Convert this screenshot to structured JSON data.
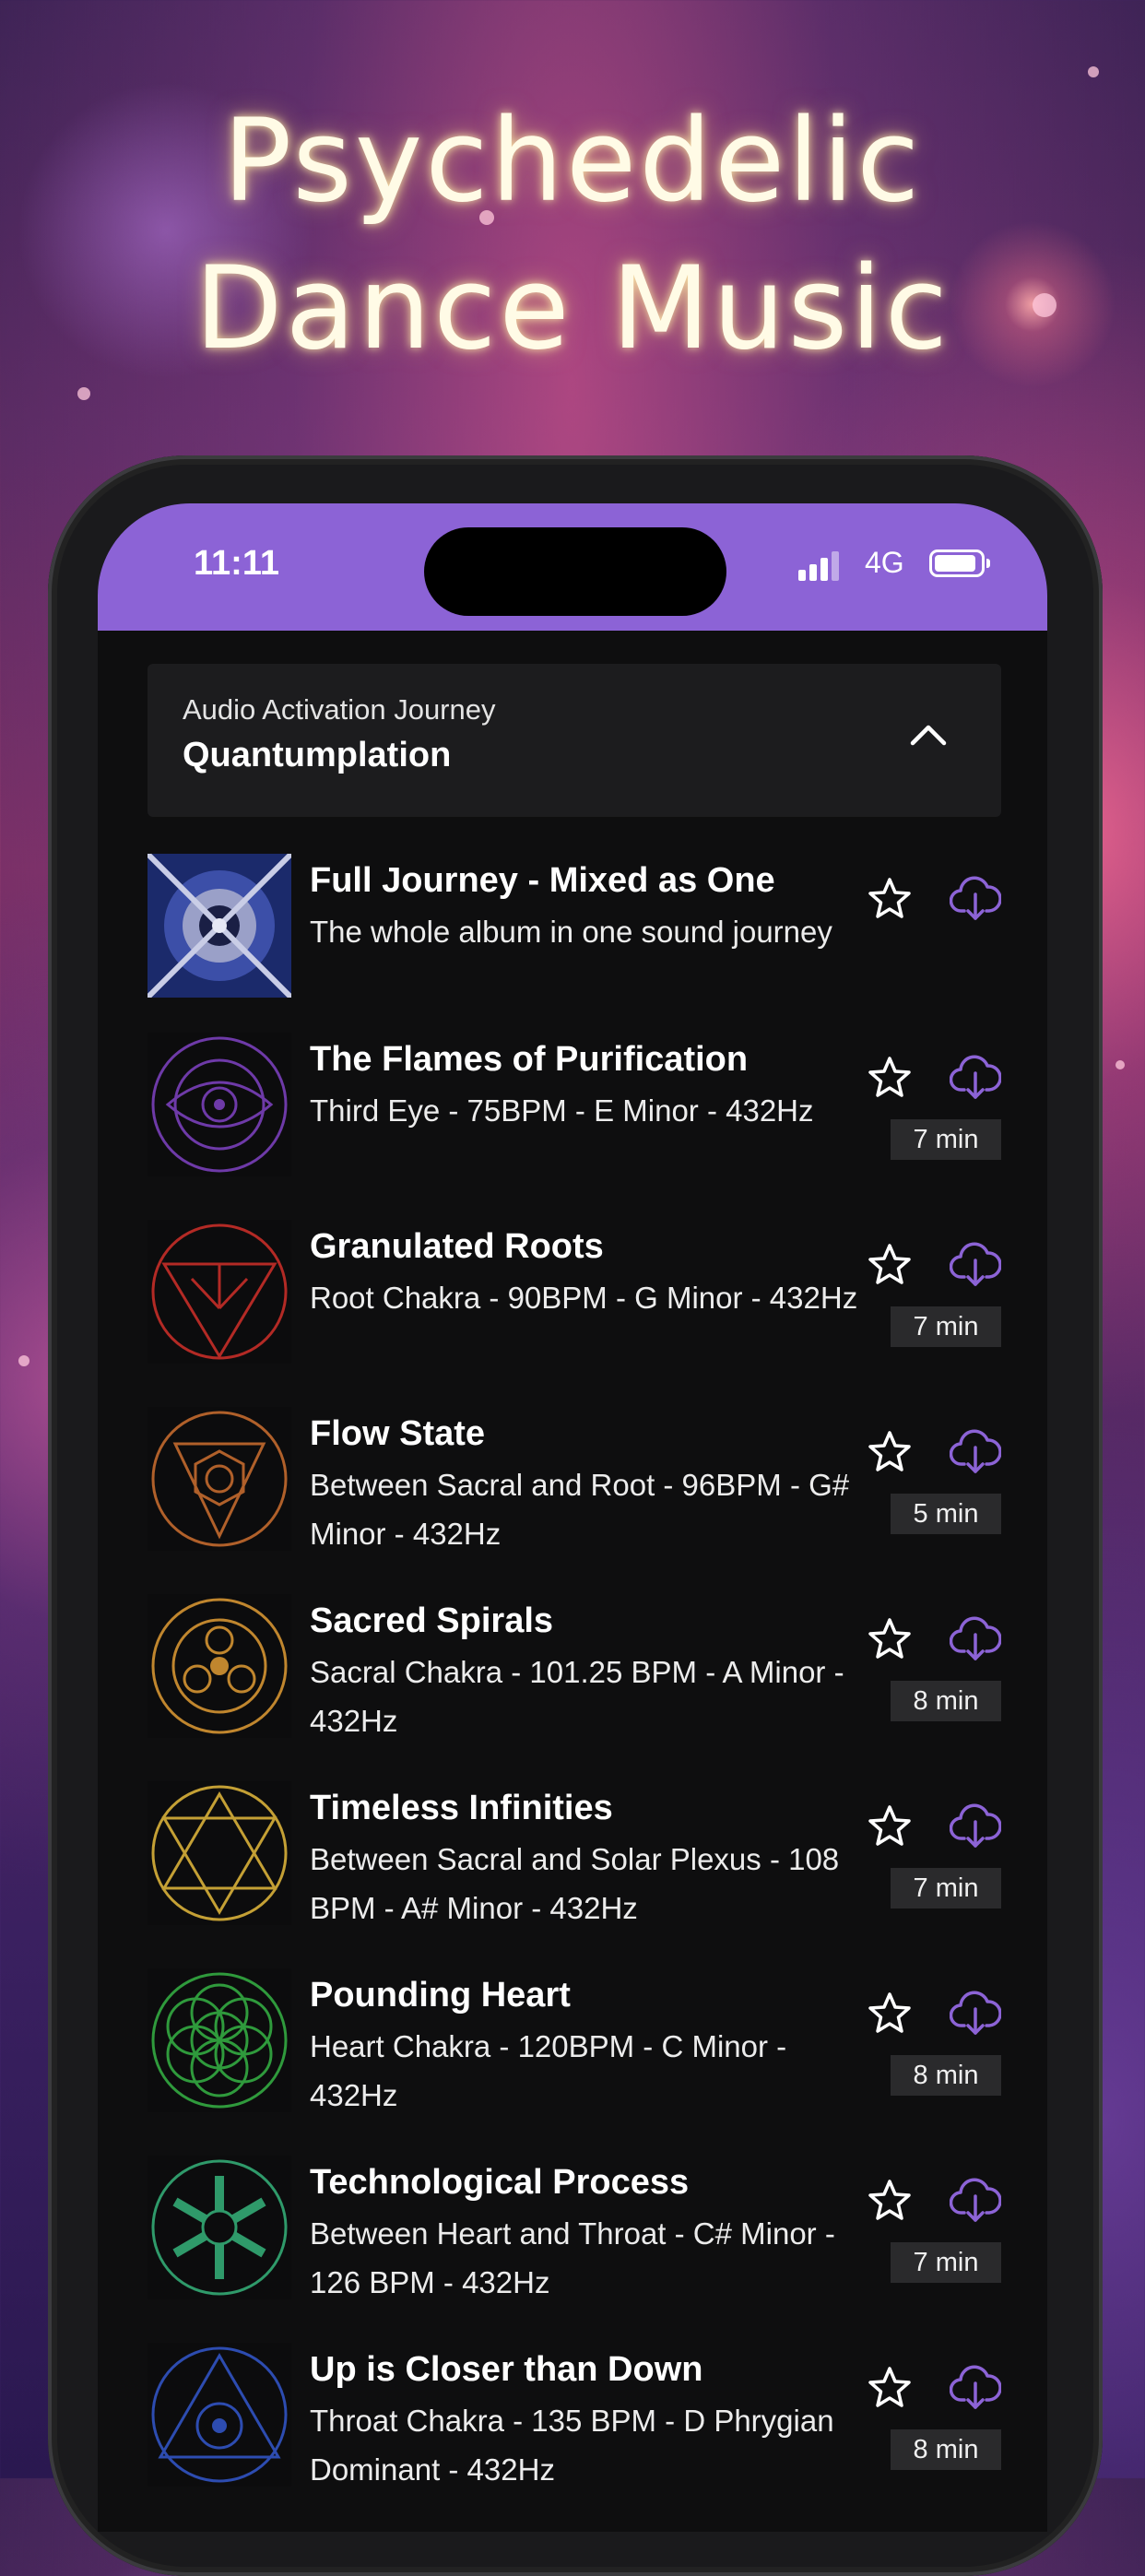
{
  "promo": {
    "title_line1": "Psychedelic",
    "title_line2": "Dance Music"
  },
  "status_bar": {
    "time": "11:11",
    "network": "4G",
    "background_color": "#8c63d6"
  },
  "journey": {
    "label": "Audio Activation Journey",
    "title": "Quantumplation"
  },
  "accent_color": "#8c63d6",
  "tracks": [
    {
      "title": "Full Journey - Mixed as One",
      "description": "The whole album in one sound journey",
      "duration": "",
      "art_icon": "mandala-photo-art"
    },
    {
      "title": "The Flames of Purification",
      "description": "Third Eye - 75BPM - E Minor - 432Hz",
      "duration": "7 min",
      "art_icon": "third-eye-symbol",
      "art_color": "#6e3aa8"
    },
    {
      "title": "Granulated Roots",
      "description": "Root Chakra - 90BPM - G Minor - 432Hz",
      "duration": "7 min",
      "art_icon": "root-chakra-symbol",
      "art_color": "#b32a25"
    },
    {
      "title": "Flow State",
      "description": "Between Sacral and Root - 96BPM - G# Minor - 432Hz",
      "duration": "5 min",
      "art_icon": "flow-state-symbol",
      "art_color": "#b0602a"
    },
    {
      "title": "Sacred Spirals",
      "description": "Sacral Chakra - 101.25 BPM - A Minor - 432Hz",
      "duration": "8 min",
      "art_icon": "sacral-chakra-symbol",
      "art_color": "#c0862e"
    },
    {
      "title": "Timeless Infinities",
      "description": "Between Sacral and Solar Plexus - 108 BPM - A# Minor - 432Hz",
      "duration": "7 min",
      "art_icon": "solar-plexus-symbol",
      "art_color": "#c4a035"
    },
    {
      "title": "Pounding Heart",
      "description": "Heart Chakra - 120BPM - C Minor - 432Hz",
      "duration": "8 min",
      "art_icon": "heart-chakra-symbol",
      "art_color": "#2f9a3c"
    },
    {
      "title": "Technological Process",
      "description": "Between Heart and Throat - C# Minor - 126 BPM - 432Hz",
      "duration": "7 min",
      "art_icon": "throat-heart-symbol",
      "art_color": "#2f9a6a"
    },
    {
      "title": "Up is Closer than Down",
      "description": "Throat Chakra - 135 BPM - D Phrygian Dominant - 432Hz",
      "duration": "8 min",
      "art_icon": "throat-chakra-symbol",
      "art_color": "#2d4cb0"
    }
  ]
}
